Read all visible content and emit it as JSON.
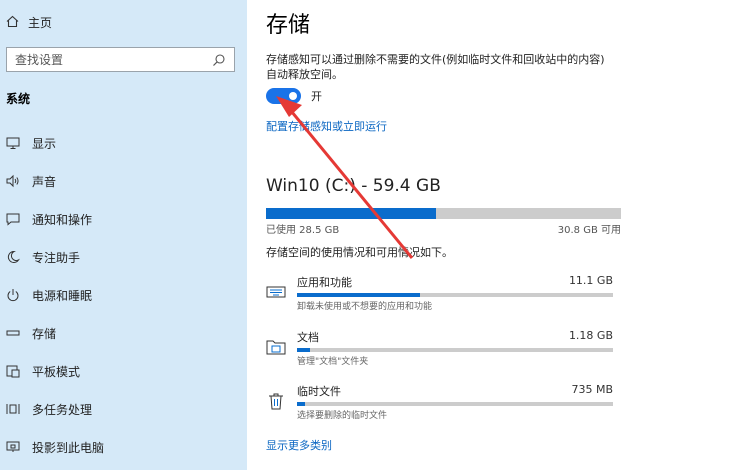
{
  "sidebar": {
    "home_label": "主页",
    "search_placeholder": "查找设置",
    "section_title": "系统",
    "items": [
      {
        "label": "显示",
        "icon": "display-icon"
      },
      {
        "label": "声音",
        "icon": "sound-icon"
      },
      {
        "label": "通知和操作",
        "icon": "notification-icon"
      },
      {
        "label": "专注助手",
        "icon": "moon-icon"
      },
      {
        "label": "电源和睡眠",
        "icon": "power-icon"
      },
      {
        "label": "存储",
        "icon": "storage-icon"
      },
      {
        "label": "平板模式",
        "icon": "tablet-icon"
      },
      {
        "label": "多任务处理",
        "icon": "multitask-icon"
      },
      {
        "label": "投影到此电脑",
        "icon": "project-icon"
      }
    ]
  },
  "main": {
    "title": "存储",
    "description_line1": "存储感知可以通过删除不需要的文件(例如临时文件和回收站中的内容)",
    "description_line2": "自动释放空间。",
    "toggle_label": "开",
    "toggle_on": true,
    "config_link": "配置存储感知或立即运行",
    "drive_title": "Win10 (C:) - 59.4 GB",
    "drive_used_fraction": 0.48,
    "used_label": "已使用 28.5 GB",
    "free_label": "30.8 GB 可用",
    "usage_desc": "存储空间的使用情况和可用情况如下。",
    "categories": [
      {
        "name": "应用和功能",
        "size": "11.1 GB",
        "sub": "卸载未使用或不想要的应用和功能",
        "fraction": 0.39,
        "icon": "apps-icon"
      },
      {
        "name": "文档",
        "size": "1.18 GB",
        "sub": "管理\"文档\"文件夹",
        "fraction": 0.04,
        "icon": "documents-icon"
      },
      {
        "name": "临时文件",
        "size": "735 MB",
        "sub": "选择要删除的临时文件",
        "fraction": 0.025,
        "icon": "trash-icon"
      }
    ],
    "more_link": "显示更多类别"
  },
  "colors": {
    "sidebar_bg": "#d5e9f8",
    "accent": "#0a6ccc",
    "toggle": "#1a73e8",
    "annotation_arrow": "#e53935"
  }
}
